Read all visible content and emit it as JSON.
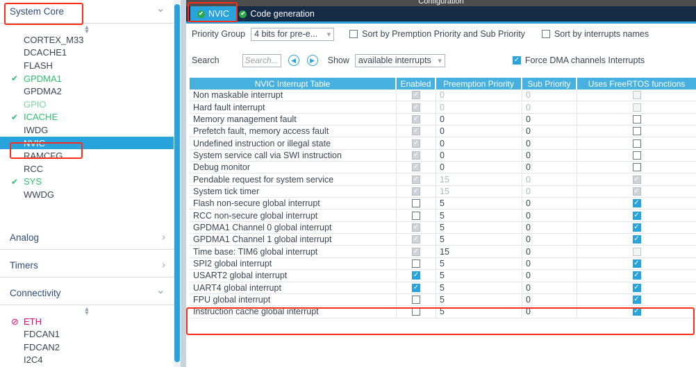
{
  "window": {
    "title": "Configuration"
  },
  "sidebar": {
    "categories": [
      {
        "name": "System Core",
        "expanded": true,
        "chevron": "chevron-down",
        "items": [
          {
            "label": "CORTEX_M33",
            "state": "none"
          },
          {
            "label": "DCACHE1",
            "state": "none"
          },
          {
            "label": "FLASH",
            "state": "none"
          },
          {
            "label": "GPDMA1",
            "state": "ok"
          },
          {
            "label": "GPDMA2",
            "state": "none"
          },
          {
            "label": "GPIO",
            "state": "soft"
          },
          {
            "label": "ICACHE",
            "state": "ok"
          },
          {
            "label": "IWDG",
            "state": "none"
          },
          {
            "label": "NVIC",
            "state": "selected"
          },
          {
            "label": "RAMCFG",
            "state": "none"
          },
          {
            "label": "RCC",
            "state": "none"
          },
          {
            "label": "SYS",
            "state": "ok"
          },
          {
            "label": "WWDG",
            "state": "none"
          }
        ]
      },
      {
        "name": "Analog",
        "expanded": false,
        "chevron": "chevron-right",
        "items": []
      },
      {
        "name": "Timers",
        "expanded": false,
        "chevron": "chevron-right",
        "items": []
      },
      {
        "name": "Connectivity",
        "expanded": true,
        "chevron": "chevron-down",
        "items": [
          {
            "label": "ETH",
            "state": "warn"
          },
          {
            "label": "FDCAN1",
            "state": "none"
          },
          {
            "label": "FDCAN2",
            "state": "none"
          },
          {
            "label": "I2C4",
            "state": "none"
          }
        ]
      }
    ],
    "marks": {
      "ok": "✔",
      "warn": "⊘"
    }
  },
  "tabs": [
    {
      "label": "NVIC",
      "selected": true,
      "icon": "check-circle-icon"
    },
    {
      "label": "Code generation",
      "selected": false,
      "icon": "check-circle-icon"
    }
  ],
  "toolbar": {
    "priority_group_label": "Priority Group",
    "priority_group_value": "4 bits for pre-e...",
    "sort_preemption_label": "Sort by Premption Priority and Sub Priority",
    "sort_preemption_checked": false,
    "sort_names_label": "Sort by interrupts names",
    "sort_names_checked": false,
    "search_label": "Search",
    "search_value": "",
    "search_placeholder": "Search...",
    "prev_icon": "◀",
    "next_icon": "▶",
    "show_label": "Show",
    "show_value": "available interrupts",
    "force_dma_label": "Force DMA channels Interrupts",
    "force_dma_checked": true
  },
  "table": {
    "headers": [
      "NVIC Interrupt Table",
      "Enabled",
      "Preemption Priority",
      "Sub Priority",
      "Uses FreeRTOS functions"
    ],
    "rows": [
      {
        "name": "Non maskable interrupt",
        "enabled": "checked-disabled",
        "preemption": "0",
        "sub": "0",
        "freertos": "unchecked-disabled",
        "dim": true,
        "highlight": false
      },
      {
        "name": "Hard fault interrupt",
        "enabled": "checked-disabled",
        "preemption": "0",
        "sub": "0",
        "freertos": "unchecked-disabled",
        "dim": true,
        "highlight": false
      },
      {
        "name": "Memory management fault",
        "enabled": "checked-disabled",
        "preemption": "0",
        "sub": "0",
        "freertos": "unchecked",
        "dim": false,
        "highlight": false
      },
      {
        "name": "Prefetch fault, memory access fault",
        "enabled": "checked-disabled",
        "preemption": "0",
        "sub": "0",
        "freertos": "unchecked",
        "dim": false,
        "highlight": false
      },
      {
        "name": "Undefined instruction or illegal state",
        "enabled": "checked-disabled",
        "preemption": "0",
        "sub": "0",
        "freertos": "unchecked",
        "dim": false,
        "highlight": false
      },
      {
        "name": "System service call via SWI instruction",
        "enabled": "checked-disabled",
        "preemption": "0",
        "sub": "0",
        "freertos": "unchecked",
        "dim": false,
        "highlight": false
      },
      {
        "name": "Debug monitor",
        "enabled": "checked-disabled",
        "preemption": "0",
        "sub": "0",
        "freertos": "unchecked",
        "dim": false,
        "highlight": false
      },
      {
        "name": "Pendable request for system service",
        "enabled": "checked-disabled",
        "preemption": "15",
        "sub": "0",
        "freertos": "checked-disabled",
        "dim": true,
        "highlight": false
      },
      {
        "name": "System tick timer",
        "enabled": "checked-disabled",
        "preemption": "15",
        "sub": "0",
        "freertos": "checked-disabled",
        "dim": true,
        "highlight": false
      },
      {
        "name": "Flash non-secure global interrupt",
        "enabled": "unchecked",
        "preemption": "5",
        "sub": "0",
        "freertos": "checked",
        "dim": false,
        "highlight": false
      },
      {
        "name": "RCC non-secure global interrupt",
        "enabled": "unchecked",
        "preemption": "5",
        "sub": "0",
        "freertos": "checked",
        "dim": false,
        "highlight": false
      },
      {
        "name": "GPDMA1 Channel 0 global interrupt",
        "enabled": "checked-disabled",
        "preemption": "5",
        "sub": "0",
        "freertos": "checked",
        "dim": false,
        "highlight": false
      },
      {
        "name": "GPDMA1 Channel 1 global interrupt",
        "enabled": "checked-disabled",
        "preemption": "5",
        "sub": "0",
        "freertos": "checked",
        "dim": false,
        "highlight": false
      },
      {
        "name": "Time base: TIM6 global interrupt",
        "enabled": "checked-disabled",
        "preemption": "15",
        "sub": "0",
        "freertos": "unchecked-disabled",
        "dim": false,
        "highlight": false
      },
      {
        "name": "SPI2 global interrupt",
        "enabled": "unchecked",
        "preemption": "5",
        "sub": "0",
        "freertos": "checked",
        "dim": false,
        "highlight": false
      },
      {
        "name": "USART2 global interrupt",
        "enabled": "checked",
        "preemption": "5",
        "sub": "0",
        "freertos": "checked",
        "dim": false,
        "highlight": true
      },
      {
        "name": "UART4 global interrupt",
        "enabled": "checked",
        "preemption": "5",
        "sub": "0",
        "freertos": "checked",
        "dim": false,
        "highlight": true
      },
      {
        "name": "FPU global interrupt",
        "enabled": "unchecked",
        "preemption": "5",
        "sub": "0",
        "freertos": "checked",
        "dim": false,
        "highlight": false
      },
      {
        "name": "Instruction cache global interrupt",
        "enabled": "unchecked",
        "preemption": "5",
        "sub": "0",
        "freertos": "checked",
        "dim": false,
        "highlight": false
      }
    ]
  },
  "annotations": {
    "color": "#ff2d17",
    "boxes": [
      {
        "name": "system-core-highlight"
      },
      {
        "name": "nvic-sidebar-highlight"
      },
      {
        "name": "nvic-tab-highlight"
      },
      {
        "name": "uart-rows-highlight"
      }
    ]
  }
}
